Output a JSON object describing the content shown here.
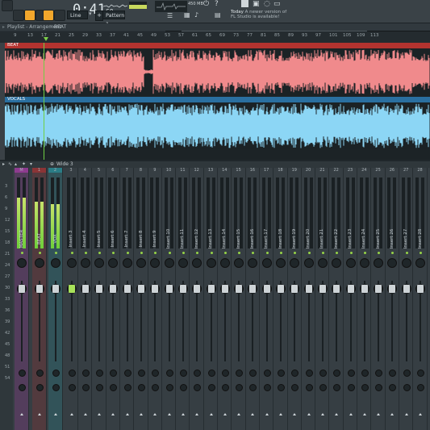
{
  "toolbar": {
    "time_main": "0:41",
    "time_sub": "60",
    "snap_value": "Line",
    "pattern_value": "Pattern 1",
    "memory": "450 MB",
    "news_date": "Today",
    "news_line1": "A newer version of",
    "news_line2": "FL Studio is available!"
  },
  "playlist": {
    "title": "Playlist - Arrangement",
    "arrow": "›",
    "clip": "BEAT",
    "ruler_ticks": [
      "9",
      "13",
      "17",
      "21",
      "25",
      "29",
      "33",
      "37",
      "41",
      "45",
      "49",
      "53",
      "57",
      "61",
      "65",
      "69",
      "73",
      "77",
      "81",
      "85",
      "89",
      "93",
      "97",
      "101",
      "105",
      "109",
      "113"
    ],
    "tracks": [
      {
        "name": "BEAT",
        "color": "#b3332f",
        "wave_color": "#f08a8c"
      },
      {
        "name": "VOCALS",
        "color": "#2a6fa0",
        "wave_color": "#8cd6f5"
      }
    ]
  },
  "mixer": {
    "title": "Wide 3",
    "scale": [
      "3",
      "6",
      "9",
      "12",
      "15",
      "18",
      "21",
      "24",
      "27",
      "30",
      "33",
      "36",
      "39",
      "42",
      "45",
      "48",
      "51",
      "54"
    ],
    "master": {
      "name": "MASTER",
      "header": "M",
      "color": "#8e3b8f",
      "level": 0.72
    },
    "beat": {
      "name": "BEAT",
      "header": "1",
      "color": "#8a3436",
      "level": 0.66
    },
    "vocals": {
      "name": "VOX",
      "header": "2",
      "color": "#2a7d86",
      "level": 0.62
    },
    "inserts": [
      {
        "name": "Insert 3",
        "header": "3"
      },
      {
        "name": "Insert 4",
        "header": "4"
      },
      {
        "name": "Insert 5",
        "header": "5"
      },
      {
        "name": "Insert 6",
        "header": "6"
      },
      {
        "name": "Insert 7",
        "header": "7"
      },
      {
        "name": "Insert 8",
        "header": "8"
      },
      {
        "name": "Insert 9",
        "header": "9"
      },
      {
        "name": "Insert 10",
        "header": "10"
      },
      {
        "name": "Insert 11",
        "header": "11"
      },
      {
        "name": "Insert 12",
        "header": "12"
      },
      {
        "name": "Insert 13",
        "header": "13"
      },
      {
        "name": "Insert 14",
        "header": "14"
      },
      {
        "name": "Insert 15",
        "header": "15"
      },
      {
        "name": "Insert 16",
        "header": "16"
      },
      {
        "name": "Insert 17",
        "header": "17"
      },
      {
        "name": "Insert 18",
        "header": "18"
      },
      {
        "name": "Insert 19",
        "header": "19"
      },
      {
        "name": "Insert 20",
        "header": "20"
      },
      {
        "name": "Insert 21",
        "header": "21"
      },
      {
        "name": "Insert 22",
        "header": "22"
      },
      {
        "name": "Insert 23",
        "header": "23"
      },
      {
        "name": "Insert 24",
        "header": "24"
      },
      {
        "name": "Insert 25",
        "header": "25"
      },
      {
        "name": "Insert 26",
        "header": "26"
      },
      {
        "name": "Insert 27",
        "header": "27"
      },
      {
        "name": "Insert 28",
        "header": "28"
      }
    ]
  }
}
